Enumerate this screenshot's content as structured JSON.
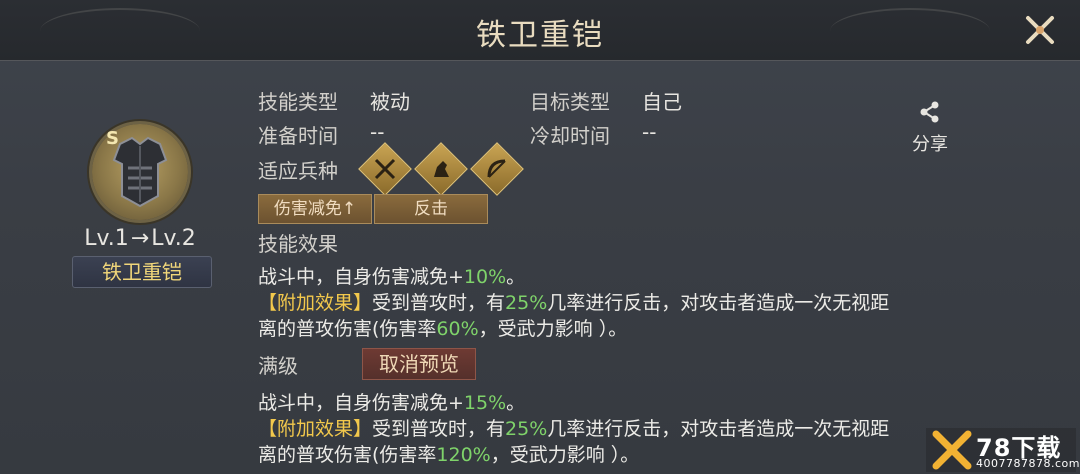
{
  "header": {
    "title": "铁卫重铠"
  },
  "skill": {
    "level_from": "Lv.1",
    "arrow": "→",
    "level_to": "Lv.2",
    "name": "铁卫重铠",
    "rank_letter": "S"
  },
  "info": {
    "skill_type_label": "技能类型",
    "skill_type_value": "被动",
    "target_type_label": "目标类型",
    "target_type_value": "自己",
    "prep_time_label": "准备时间",
    "prep_time_value": "--",
    "cooldown_label": "冷却时间",
    "cooldown_value": "--",
    "troop_label": "适应兵种",
    "troops": [
      "spear-troop-icon",
      "cavalry-troop-icon",
      "archer-troop-icon"
    ]
  },
  "share": {
    "label": "分享"
  },
  "tags": [
    "伤害减免↑",
    "反击"
  ],
  "effect": {
    "title": "技能效果",
    "line1_a": "战斗中，自身伤害减免+",
    "line1_pct": "10%",
    "line1_b": "。",
    "extra_tag": "【附加效果】",
    "line2_a": "受到普攻时，有",
    "line2_pct": "25%",
    "line2_b": "几率进行反击，对攻击者造成一次无视距",
    "line3_a": "离的普攻伤害(伤害率",
    "line3_pct": "60%",
    "line3_b": "，受武力影响 ）。"
  },
  "max_level": {
    "title": "满级",
    "cancel_label": "取消预览",
    "line1_a": "战斗中，自身伤害减免+",
    "line1_pct": "15%",
    "line1_b": "。",
    "extra_tag": "【附加效果】",
    "line2_a": "受到普攻时，有",
    "line2_pct": "25%",
    "line2_b": "几率进行反击，对攻击者造成一次无视距",
    "line3_a": "离的普攻伤害(伤害率",
    "line3_pct": "120%",
    "line3_b": "，受武力影响 ）。"
  },
  "watermark": {
    "brand": "78下载",
    "url": "4007787878.com"
  },
  "colors": {
    "highlight_green": "#7fd36a",
    "highlight_gold": "#f2c84c",
    "title_gold": "#e9dcc0",
    "name_gold": "#f0d67a"
  }
}
